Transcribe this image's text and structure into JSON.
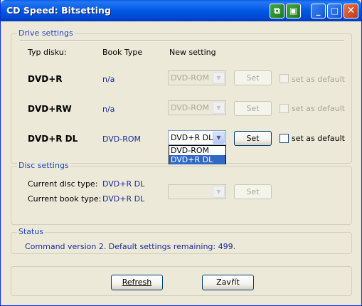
{
  "window": {
    "title": "CD Speed: Bitsetting",
    "controls": [
      "copy-icon",
      "save-icon",
      "minimize-icon",
      "maximize-icon",
      "close-icon"
    ]
  },
  "drive_settings": {
    "legend": "Drive settings",
    "headers": {
      "type": "Typ disku:",
      "book": "Book Type",
      "new": "New setting"
    },
    "rows": [
      {
        "type": "DVD+R",
        "book": "n/a",
        "combo": "DVD-ROM",
        "set": "Set",
        "checkbox": "set as default",
        "enabled": false
      },
      {
        "type": "DVD+RW",
        "book": "n/a",
        "combo": "DVD-ROM",
        "set": "Set",
        "checkbox": "set as default",
        "enabled": false
      },
      {
        "type": "DVD+R DL",
        "book": "DVD-ROM",
        "combo": "DVD+R DL",
        "set": "Set",
        "checkbox": "set as default",
        "enabled": true
      }
    ],
    "dropdown_options": [
      "DVD-ROM",
      "DVD+R DL"
    ],
    "dropdown_selected": "DVD+R DL"
  },
  "disc_settings": {
    "legend": "Disc settings",
    "current_disc_label": "Current disc type:",
    "current_disc_value": "DVD+R DL",
    "current_book_label": "Current book type:",
    "current_book_value": "DVD+R DL",
    "combo": "",
    "set": "Set"
  },
  "status": {
    "legend": "Status",
    "text": "Command version 2. Default settings remaining: 499."
  },
  "buttons": {
    "refresh": "Refresh",
    "close": "Zavřít"
  },
  "colors": {
    "accent": "#1a2a99",
    "legend": "#1e46c8",
    "titlebar": "#0058e6",
    "selection": "#316ac5"
  }
}
